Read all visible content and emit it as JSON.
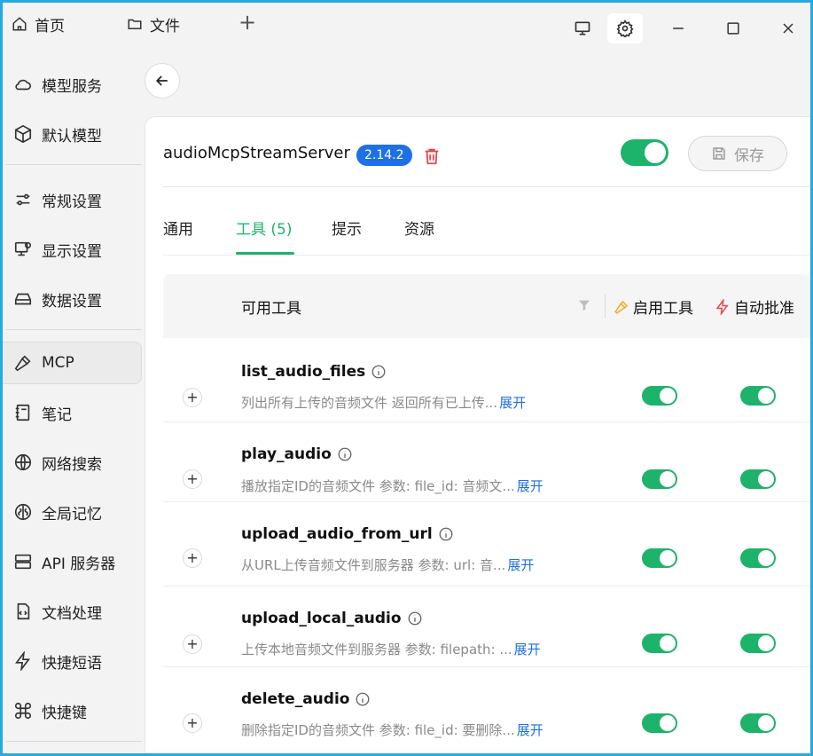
{
  "titlebar": {
    "tabs": [
      {
        "label": "首页",
        "icon": "home-icon"
      },
      {
        "label": "文件",
        "icon": "folder-icon"
      }
    ],
    "add_tab_label": "+",
    "controls": [
      "monitor-icon",
      "gear-icon",
      "minimize-icon",
      "maximize-icon",
      "close-icon"
    ]
  },
  "sidebar": {
    "items": [
      {
        "label": "模型服务",
        "icon": "cloud-icon"
      },
      {
        "label": "默认模型",
        "icon": "cube-icon"
      },
      {
        "label": "常规设置",
        "icon": "sliders-icon"
      },
      {
        "label": "显示设置",
        "icon": "display-icon"
      },
      {
        "label": "数据设置",
        "icon": "storage-icon"
      },
      {
        "label": "MCP",
        "icon": "hammer-icon",
        "active": true
      },
      {
        "label": "笔记",
        "icon": "note-icon"
      },
      {
        "label": "网络搜索",
        "icon": "globe-icon"
      },
      {
        "label": "全局记忆",
        "icon": "brain-icon"
      },
      {
        "label": "API 服务器",
        "icon": "server-icon"
      },
      {
        "label": "文档处理",
        "icon": "document-icon"
      },
      {
        "label": "快捷短语",
        "icon": "zap-icon"
      },
      {
        "label": "快捷键",
        "icon": "command-icon"
      }
    ]
  },
  "server": {
    "name": "audioMcpStreamServer",
    "version": "2.14.2",
    "enabled": true,
    "save_label": "保存"
  },
  "tabs": [
    {
      "label": "通用",
      "active": false
    },
    {
      "label": "工具 (5)",
      "active": true
    },
    {
      "label": "提示",
      "active": false
    },
    {
      "label": "资源",
      "active": false
    }
  ],
  "table": {
    "col_tools": "可用工具",
    "col_enable": "启用工具",
    "col_auto": "自动批准",
    "expand_label": "+",
    "rows": [
      {
        "name": "list_audio_files",
        "desc": "列出所有上传的音频文件 返回所有已上传...",
        "more": "展开",
        "enabled": true,
        "auto": true
      },
      {
        "name": "play_audio",
        "desc": "播放指定ID的音频文件 参数: file_id: 音频文...",
        "more": "展开",
        "enabled": true,
        "auto": true
      },
      {
        "name": "upload_audio_from_url",
        "desc": "从URL上传音频文件到服务器 参数: url: 音...",
        "more": "展开",
        "enabled": true,
        "auto": true
      },
      {
        "name": "upload_local_audio",
        "desc": "上传本地音频文件到服务器 参数: filepath: ...",
        "more": "展开",
        "enabled": true,
        "auto": true
      },
      {
        "name": "delete_audio",
        "desc": "删除指定ID的音频文件 参数: file_id: 要删除...",
        "more": "展开",
        "enabled": true,
        "auto": true
      }
    ]
  },
  "colors": {
    "accent_green": "#1db36a",
    "badge_blue": "#1f6fe5",
    "delete_red": "#e5484d",
    "enable_icon_orange": "#f5a623",
    "auto_icon_red": "#e5484d",
    "frame_border": "#26a9e0"
  }
}
